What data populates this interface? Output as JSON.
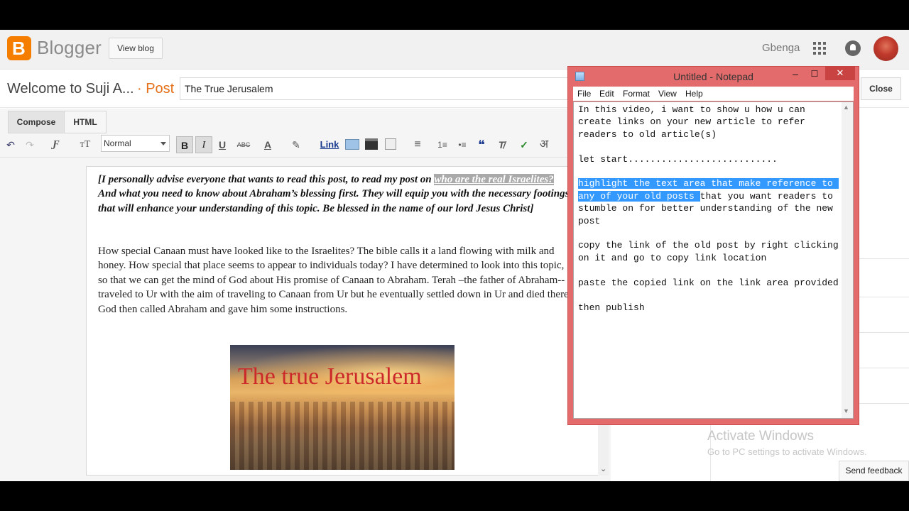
{
  "header": {
    "app_name": "Blogger",
    "view_blog_label": "View blog",
    "username": "Gbenga"
  },
  "post": {
    "blog_name": "Welcome to Suji A...",
    "post_tag": "· Post",
    "title_value": "The True Jerusalem",
    "close_label": "Close"
  },
  "tabs": [
    {
      "label": "Compose"
    },
    {
      "label": "HTML"
    }
  ],
  "toolbar": {
    "undo": "↶",
    "redo": "↷",
    "font": "Ƒ",
    "size": "тT",
    "format": "Normal",
    "bold": "B",
    "italic": "I",
    "underline": "U",
    "strike": "ABC",
    "text_color": "A",
    "highlight": "✎",
    "link": "Link",
    "align": "≡",
    "numbered": "1≡",
    "bulleted": "•≡",
    "quote": "❝",
    "clear": "T̸",
    "spell": "✓",
    "translit": "अ"
  },
  "editor": {
    "intro_before": "[I personally advise everyone that wants to read this post, to read my post on ",
    "intro_link": "who are the real Israelites?",
    "intro_after": " And what you need to know about Abraham’s blessing first. They will equip you with the necessary footings that will enhance your understanding of this topic. Be blessed in the name of our lord Jesus Christ]",
    "body": "How special Canaan must have looked like to the Israelites? The bible calls it a land flowing with milk and honey. How special that place seems to appear to individuals today? I have determined to look into this topic, so that we can get the mind of God about His promise of Canaan to Abraham. Terah –the father of Abraham-- traveled to Ur with the aim of traveling to Canaan from Ur but he eventually settled down in Ur and died there. God then called Abraham and gave him some instructions.",
    "image_caption": "The true Jerusalem"
  },
  "notepad": {
    "title": "Untitled - Notepad",
    "menus": [
      "File",
      "Edit",
      "Format",
      "View",
      "Help"
    ],
    "text_before": "In this video, i want to show u how u can create links on your new article to refer readers to old article(s)\n\nlet start...........................\n\n",
    "text_selected": "highlight the text area that make reference to any of your old posts ",
    "text_after": "that you want readers to stumble on for better understanding of the new post\n\ncopy the link of the old post by right clicking on it and go to copy link location\n\npaste the copied link on the link area provided\n\nthen publish"
  },
  "system": {
    "activate_title": "Activate Windows",
    "activate_sub": "Go to PC settings to activate Windows.",
    "feedback_label": "Send feedback"
  },
  "colors": {
    "blogger_orange": "#f57d00",
    "post_tag": "#e5711b",
    "notepad_frame": "#e36b6b",
    "selection": "#3399ff"
  }
}
